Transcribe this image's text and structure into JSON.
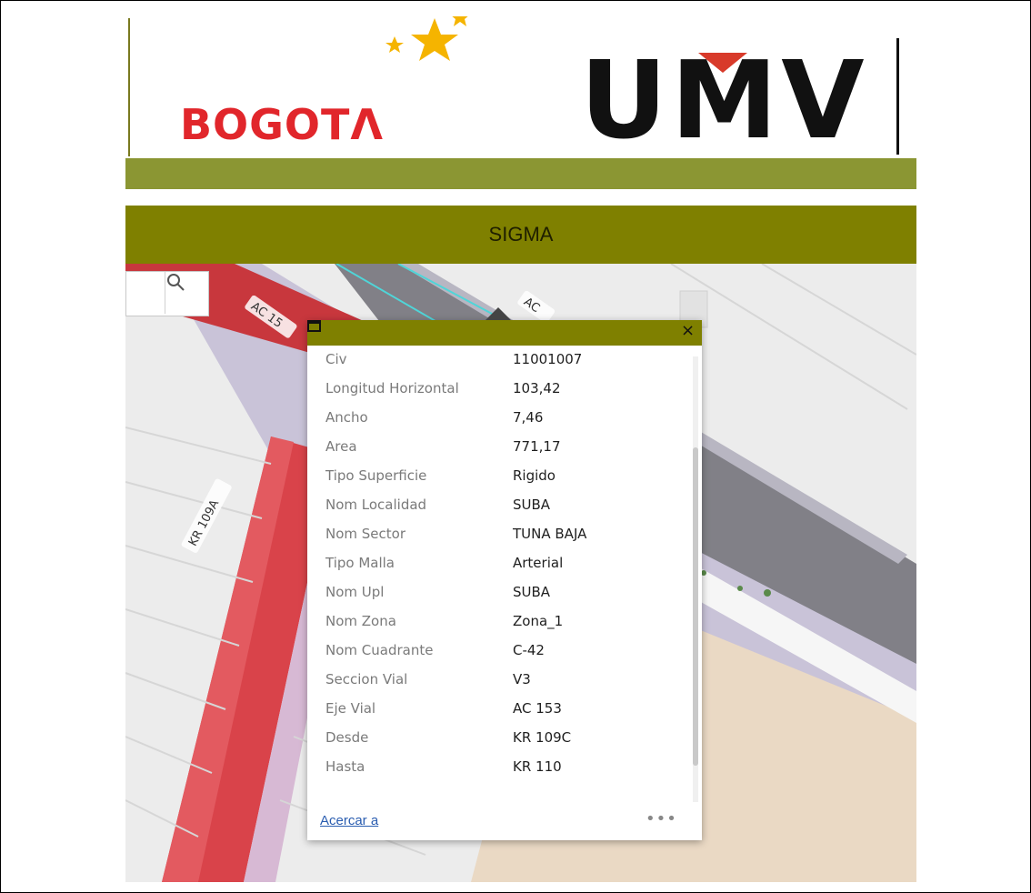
{
  "header": {
    "logo_left_text": "BOGOTΛ",
    "logo_right_text": "UMV"
  },
  "title": "SIGMA",
  "map": {
    "street_labels": [
      "AC 15",
      "AC",
      "KR 109A"
    ]
  },
  "popup": {
    "fields": [
      {
        "label": "Civ",
        "value": "11001007"
      },
      {
        "label": "Longitud Horizontal",
        "value": "103,42"
      },
      {
        "label": "Ancho",
        "value": "7,46"
      },
      {
        "label": "Area",
        "value": "771,17"
      },
      {
        "label": "Tipo Superficie",
        "value": "Rigido"
      },
      {
        "label": "Nom Localidad",
        "value": "SUBA"
      },
      {
        "label": "Nom Sector",
        "value": "TUNA BAJA"
      },
      {
        "label": "Tipo Malla",
        "value": "Arterial"
      },
      {
        "label": "Nom Upl",
        "value": "SUBA"
      },
      {
        "label": "Nom Zona",
        "value": "Zona_1"
      },
      {
        "label": "Nom Cuadrante",
        "value": "C-42"
      },
      {
        "label": "Seccion Vial",
        "value": "V3"
      },
      {
        "label": "Eje Vial",
        "value": "AC 153"
      },
      {
        "label": "Desde",
        "value": "KR 109C"
      },
      {
        "label": "Hasta",
        "value": "KR 110"
      }
    ],
    "zoom_link": "Acercar a",
    "more": "•••"
  },
  "icons": {
    "search": "search-icon",
    "maximize": "maximize-icon",
    "close": "close-icon"
  },
  "colors": {
    "header_olive": "#7f8000",
    "band_olive": "#8b9633",
    "road_red": "#d9434a",
    "brand_red": "#e1262b"
  }
}
